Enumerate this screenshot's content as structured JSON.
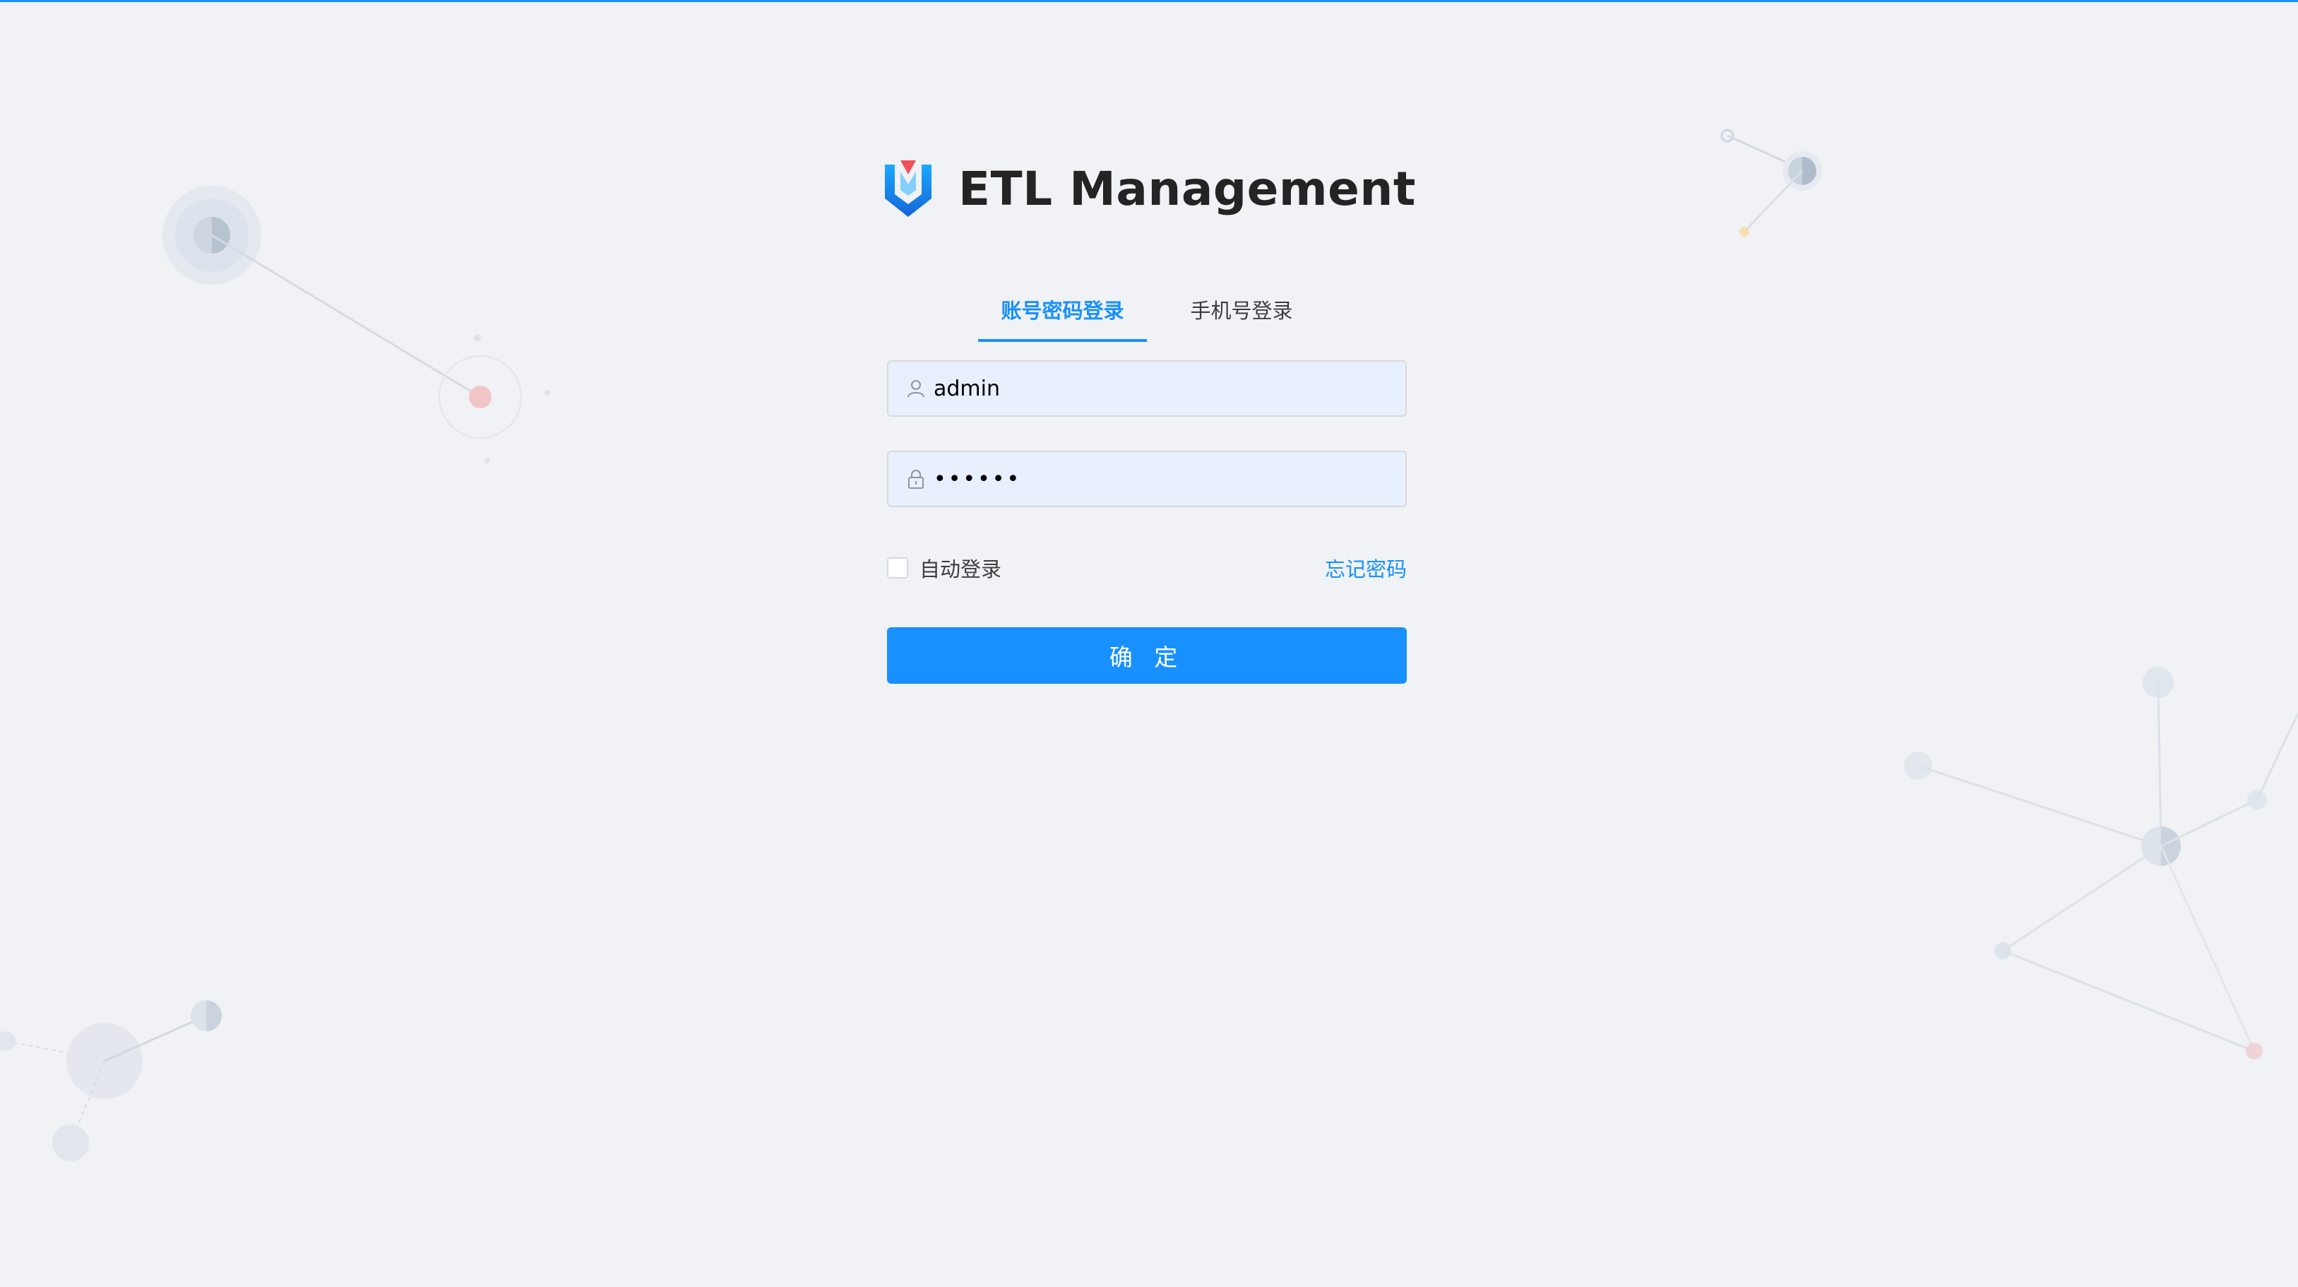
{
  "header": {
    "title": "ETL Management"
  },
  "tabs": [
    {
      "label": "账号密码登录",
      "active": true
    },
    {
      "label": "手机号登录",
      "active": false
    }
  ],
  "form": {
    "username_value": "admin",
    "password_value": "••••••",
    "remember_label": "自动登录",
    "remember_checked": false,
    "forgot_label": "忘记密码",
    "submit_label": "确 定"
  },
  "colors": {
    "accent": "#1890ff",
    "background": "#f0f2f5",
    "input_fill": "#e8f0fe"
  },
  "icons": {
    "logo": "shield-v-logo",
    "username": "user-icon",
    "password": "lock-icon"
  }
}
